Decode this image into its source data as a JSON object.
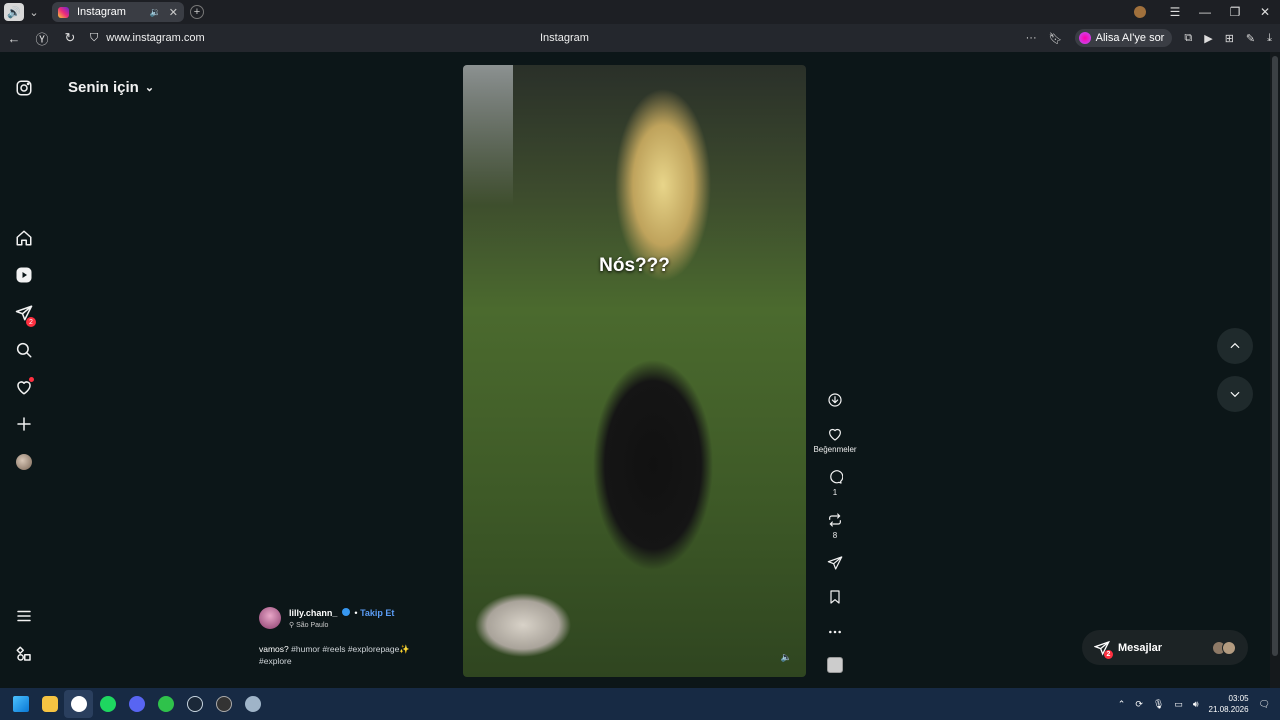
{
  "browser": {
    "tab_title": "Instagram",
    "url": "www.instagram.com",
    "page_title": "Instagram",
    "assistant_label": "Alisa AI'ye sor"
  },
  "instagram": {
    "feed_selector": "Senin için",
    "sidebar": {
      "icons": [
        "instagram-logo-icon",
        "home-icon",
        "reels-icon",
        "messages-icon",
        "search-icon",
        "notifications-icon",
        "create-icon",
        "profile-avatar",
        "menu-icon",
        "more-apps-icon"
      ],
      "messages_badge": "2"
    },
    "reel": {
      "caption_overlay": "Nós???",
      "author": "lilly.chann_",
      "follow_label": "Takip Et",
      "location": "São Paulo",
      "description": "vamos?",
      "hashtags": "#humor #reels #explorepage✨ #explore"
    },
    "actions": {
      "likes_label": "Beğenmeler",
      "comments_count": "1",
      "reposts_count": "8"
    },
    "messages_label": "Mesajlar",
    "messages_badge": "2"
  },
  "taskbar": {
    "time": "03:05",
    "date": "21.08.2026"
  },
  "colors": {
    "background": "#0c1618",
    "accent": "#3797f0",
    "badge": "#ff3040"
  }
}
